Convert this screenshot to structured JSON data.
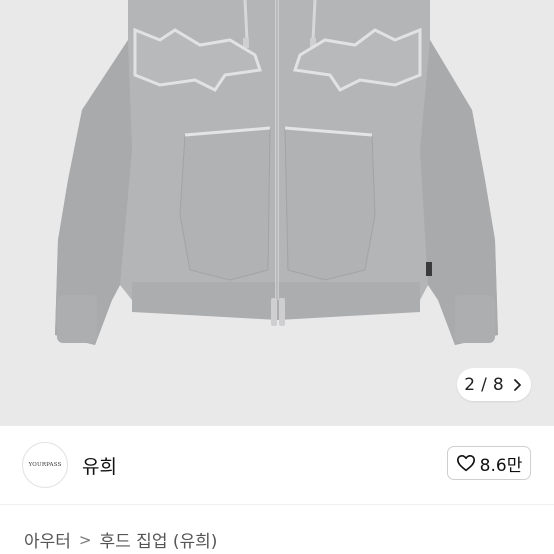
{
  "gallery": {
    "current_page": "2",
    "divider": "/",
    "total_pages": "8",
    "next_icon": "chevron-right-icon",
    "bg_color": "#e9e9ea"
  },
  "seller": {
    "avatar_brand": "YOURPASS",
    "name": "유희"
  },
  "like": {
    "icon": "heart-outline-icon",
    "count": "8.6만"
  },
  "breadcrumb": {
    "category": "아우터",
    "separator": ">",
    "subcategory": "후드 집업 (유희)"
  }
}
